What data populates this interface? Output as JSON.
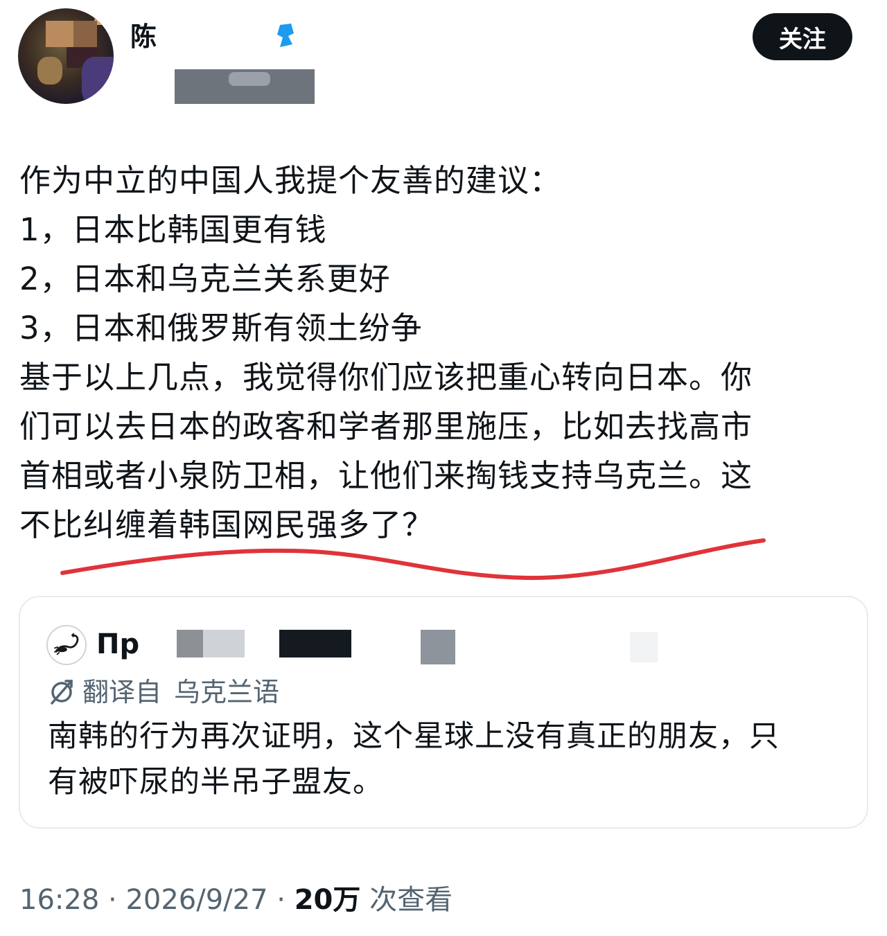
{
  "author": {
    "name_visible": "陈",
    "follow_label": "关注"
  },
  "tweet": {
    "lines": [
      "作为中立的中国人我提个友善的建议：",
      "1，日本比韩国更有钱",
      "2，日本和乌克兰关系更好",
      "3，日本和俄罗斯有领土纷争",
      "基于以上几点，我觉得你们应该把重心转向日本。你",
      "们可以去日本的政客和学者那里施压，比如去找高市",
      "首相或者小泉防卫相，让他们来掏钱支持乌克兰。这",
      "不比纠缠着韩国网民强多了？"
    ]
  },
  "quote": {
    "name_visible": "Пр",
    "translate_label": "翻译自",
    "translate_language": "乌克兰语",
    "lines": [
      "南韩的行为再次证明，这个星球上没有真正的朋友，只",
      "有被吓尿的半吊子盟友。"
    ]
  },
  "meta": {
    "time": "16:28",
    "separator": " · ",
    "date": "2026/9/27",
    "views_count": "20万",
    "views_label": "次查看"
  },
  "colors": {
    "text": "#0f1419",
    "secondary": "#536471",
    "verified": "#1d9bf0",
    "underline_annotation": "#e0333a",
    "card_border": "#e6ebef"
  },
  "icons": {
    "verified": "verified-badge-icon",
    "translate": "translate-icon",
    "quote_avatar": "scorpion-avatar-icon"
  }
}
